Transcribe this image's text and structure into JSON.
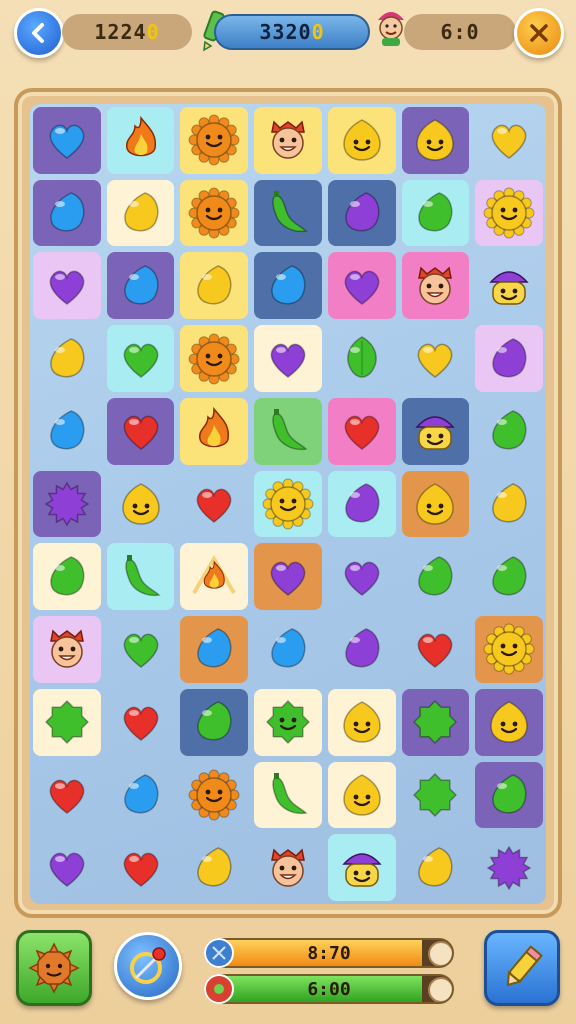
{
  "hud": {
    "score": "1224",
    "score_suffix": "0",
    "target": "3320",
    "target_suffix": "0",
    "time": "6:0",
    "back_icon": "chevron-left-icon",
    "close_icon": "close-icon"
  },
  "colors": {
    "red": "#e8302a",
    "orange": "#f08a1a",
    "yellow": "#f7c81e",
    "green": "#3fbf2b",
    "blue": "#2a9df0",
    "purple": "#8e3fd6",
    "tile_purple": "#7b63b8",
    "tile_yellow": "#fbe37a",
    "tile_pink": "#f27fc6",
    "tile_cream": "#fff3d6",
    "tile_cyan": "#a9ecf2",
    "tile_navy": "#4e6fa8",
    "tile_orange": "#e3964b",
    "tile_green": "#7fd27a",
    "tile_lilac": "#eac6f5"
  },
  "board": {
    "columns": 7,
    "rows": [
      [
        {
          "p": "heart-blue",
          "t": "tile_purple"
        },
        {
          "p": "flame",
          "t": "tile_cyan"
        },
        {
          "p": "sun-orange",
          "t": "tile_yellow"
        },
        {
          "p": "face-red",
          "t": "tile_yellow"
        },
        {
          "p": "blob-yellow",
          "t": "tile_yellow"
        },
        {
          "p": "blob-yellow",
          "t": "tile_purple"
        },
        {
          "p": "heart-yellow",
          "t": ""
        }
      ],
      [
        {
          "p": "drop-blue",
          "t": "tile_purple"
        },
        {
          "p": "drop-yellow",
          "t": "tile_cream"
        },
        {
          "p": "sun-orange",
          "t": "tile_yellow"
        },
        {
          "p": "pepper-green",
          "t": "tile_navy"
        },
        {
          "p": "drop-purple",
          "t": "tile_navy"
        },
        {
          "p": "drop-green",
          "t": "tile_cyan"
        },
        {
          "p": "sun-yellow",
          "t": "tile_lilac"
        }
      ],
      [
        {
          "p": "heart-purple",
          "t": "tile_lilac"
        },
        {
          "p": "drop-blue",
          "t": "tile_purple"
        },
        {
          "p": "drop-yellow",
          "t": "tile_yellow"
        },
        {
          "p": "drop-blue",
          "t": "tile_navy"
        },
        {
          "p": "heart-purple",
          "t": "tile_pink"
        },
        {
          "p": "face-red",
          "t": "tile_pink"
        },
        {
          "p": "wizard-purple",
          "t": ""
        }
      ],
      [
        {
          "p": "drop-yellow",
          "t": ""
        },
        {
          "p": "heart-green",
          "t": "tile_cyan"
        },
        {
          "p": "sun-orange",
          "t": "tile_yellow"
        },
        {
          "p": "heart-purple",
          "t": "tile_cream"
        },
        {
          "p": "leaf-green",
          "t": ""
        },
        {
          "p": "heart-yellow",
          "t": ""
        },
        {
          "p": "drop-purple",
          "t": "tile_lilac"
        }
      ],
      [
        {
          "p": "drop-blue",
          "t": ""
        },
        {
          "p": "heart-red",
          "t": "tile_purple"
        },
        {
          "p": "flame",
          "t": "tile_yellow"
        },
        {
          "p": "pepper-green",
          "t": "tile_green"
        },
        {
          "p": "heart-red",
          "t": "tile_pink"
        },
        {
          "p": "wizard-purple",
          "t": "tile_navy"
        },
        {
          "p": "drop-green",
          "t": ""
        }
      ],
      [
        {
          "p": "spiky-purple",
          "t": "tile_purple"
        },
        {
          "p": "blob-yellow",
          "t": ""
        },
        {
          "p": "heart-red",
          "t": ""
        },
        {
          "p": "sun-yellow",
          "t": "tile_cyan"
        },
        {
          "p": "drop-purple",
          "t": "tile_cyan"
        },
        {
          "p": "blob-yellow",
          "t": "tile_orange"
        },
        {
          "p": "drop-yellow",
          "t": ""
        }
      ],
      [
        {
          "p": "drop-green",
          "t": "tile_cream"
        },
        {
          "p": "pepper-green",
          "t": "tile_cyan"
        },
        {
          "p": "campfire",
          "t": "tile_cream"
        },
        {
          "p": "heart-purple",
          "t": "tile_orange"
        },
        {
          "p": "heart-purple",
          "t": ""
        },
        {
          "p": "drop-green",
          "t": ""
        },
        {
          "p": "drop-green",
          "t": ""
        }
      ],
      [
        {
          "p": "face-red",
          "t": "tile_lilac"
        },
        {
          "p": "heart-green",
          "t": ""
        },
        {
          "p": "drop-blue",
          "t": "tile_orange"
        },
        {
          "p": "drop-blue",
          "t": ""
        },
        {
          "p": "drop-purple",
          "t": ""
        },
        {
          "p": "heart-red",
          "t": ""
        },
        {
          "p": "sun-yellow",
          "t": "tile_orange"
        }
      ],
      [
        {
          "p": "splat-green",
          "t": "tile_cream"
        },
        {
          "p": "heart-red",
          "t": ""
        },
        {
          "p": "drop-green",
          "t": "tile_navy"
        },
        {
          "p": "monster-green",
          "t": "tile_cream"
        },
        {
          "p": "blob-yellow",
          "t": "tile_cream"
        },
        {
          "p": "splat-green",
          "t": "tile_purple"
        },
        {
          "p": "blob-yellow",
          "t": "tile_purple"
        }
      ],
      [
        {
          "p": "heart-red",
          "t": ""
        },
        {
          "p": "drop-blue",
          "t": ""
        },
        {
          "p": "sun-orange",
          "t": ""
        },
        {
          "p": "pepper-green",
          "t": "tile_cream"
        },
        {
          "p": "blob-yellow",
          "t": "tile_cream"
        },
        {
          "p": "splat-green",
          "t": ""
        },
        {
          "p": "drop-green",
          "t": "tile_purple"
        }
      ],
      [
        {
          "p": "heart-purple",
          "t": ""
        },
        {
          "p": "heart-red",
          "t": ""
        },
        {
          "p": "drop-yellow",
          "t": ""
        },
        {
          "p": "face-red",
          "t": ""
        },
        {
          "p": "wizard-purple",
          "t": "tile_cyan"
        },
        {
          "p": "drop-yellow",
          "t": ""
        },
        {
          "p": "spiky-purple",
          "t": ""
        }
      ]
    ]
  },
  "bottom": {
    "bar1_label": "8:70",
    "bar1_progress": 0.88,
    "bar2_label": "6:00",
    "bar2_progress": 0.88,
    "booster_icon": "sun-face-icon",
    "target_icon": "pin-target-icon",
    "hammer_icon": "pencil-icon"
  }
}
